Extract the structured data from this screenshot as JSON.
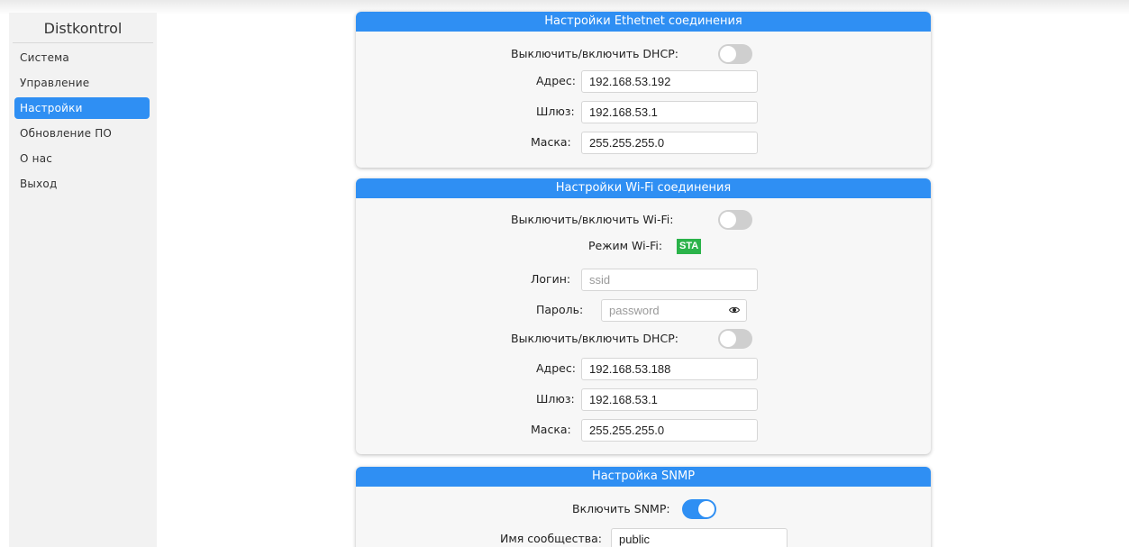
{
  "sidebar": {
    "brand": "Distkontrol",
    "items": [
      {
        "label": "Система"
      },
      {
        "label": "Управление"
      },
      {
        "label": "Настройки"
      },
      {
        "label": "Обновление ПО"
      },
      {
        "label": "О нас"
      },
      {
        "label": "Выход"
      }
    ],
    "active_index": 2
  },
  "ethernet": {
    "title": "Настройки Ethetnet соединения",
    "dhcp_label": "Выключить/включить DHCP:",
    "dhcp_enabled": false,
    "address_label": "Адрес:",
    "address": "192.168.53.192",
    "gateway_label": "Шлюз:",
    "gateway": "192.168.53.1",
    "mask_label": "Маска:",
    "mask": "255.255.255.0"
  },
  "wifi": {
    "title": "Настройки Wi-Fi соединения",
    "wifi_toggle_label": "Выключить/включить Wi-Fi:",
    "wifi_enabled": false,
    "mode_label": "Режим Wi-Fi:",
    "mode": "STA",
    "login_label": "Логин:",
    "login_value": "",
    "login_placeholder": "ssid",
    "password_label": "Пароль:",
    "password_value": "",
    "password_placeholder": "password",
    "dhcp_label": "Выключить/включить DHCP:",
    "dhcp_enabled": false,
    "address_label": "Адрес:",
    "address": "192.168.53.188",
    "gateway_label": "Шлюз:",
    "gateway": "192.168.53.1",
    "mask_label": "Маска:",
    "mask": "255.255.255.0"
  },
  "snmp": {
    "title": "Настройка SNMP",
    "enable_label": "Включить SNMP:",
    "enabled": true,
    "community_label": "Имя сообщества:",
    "community": "public"
  },
  "colors": {
    "accent": "#2f8ff3",
    "badge": "#2bb34a",
    "sidebar_bg": "#f2f2f2",
    "card_bg": "#f7f7f7"
  },
  "icons": {
    "password_toggle": "eye-icon"
  }
}
